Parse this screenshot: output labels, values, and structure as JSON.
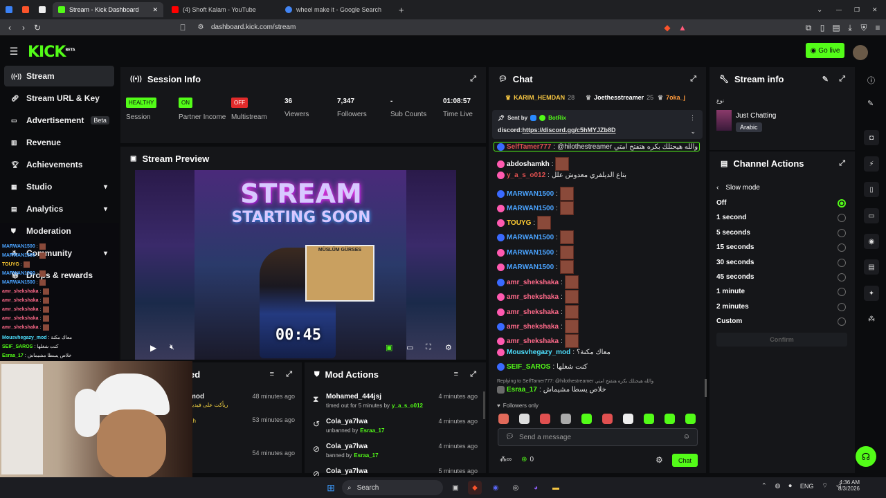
{
  "browser": {
    "tabs": [
      {
        "title": "Stream - Kick Dashboard",
        "color": "#53fc18"
      },
      {
        "title": "(4) Shoft Kalam - YouTube",
        "color": "#ff0000"
      },
      {
        "title": "wheel make it - Google Search",
        "color": "#4285f4"
      }
    ],
    "url": "dashboard.kick.com/stream",
    "new_tab": "+"
  },
  "header": {
    "logo": "KICK",
    "logo_badge": "BETA",
    "go_live": "Go live"
  },
  "sidebar": {
    "items": [
      {
        "label": "Stream",
        "icon": "broadcast-icon",
        "active": true
      },
      {
        "label": "Stream URL & Key",
        "icon": "link-icon"
      },
      {
        "label": "Advertisement",
        "icon": "ad-icon",
        "badge": "Beta"
      },
      {
        "label": "Revenue",
        "icon": "revenue-icon"
      },
      {
        "label": "Achievements",
        "icon": "trophy-icon"
      },
      {
        "label": "Studio",
        "icon": "studio-icon",
        "expand": "▾"
      },
      {
        "label": "Analytics",
        "icon": "analytics-icon",
        "expand": "▾"
      },
      {
        "label": "Moderation",
        "icon": "shield-icon"
      },
      {
        "label": "Community",
        "icon": "community-icon",
        "expand": "▾"
      },
      {
        "label": "Drops & rewards",
        "icon": "gift-icon"
      }
    ]
  },
  "session": {
    "title": "Session Info",
    "stats": [
      {
        "badge": "HEALTHY",
        "label": "Session",
        "badge_color": "#53fc18"
      },
      {
        "badge": "ON",
        "label": "Partner Income",
        "badge_color": "#53fc18"
      },
      {
        "badge": "OFF",
        "label": "Multistream",
        "badge_color": "#e02b2b"
      },
      {
        "value": "36",
        "label": "Viewers"
      },
      {
        "value": "7,347",
        "label": "Followers"
      },
      {
        "value": "-",
        "label": "Sub Counts"
      },
      {
        "value": "01:08:57",
        "label": "Time Live"
      }
    ]
  },
  "preview": {
    "title": "Stream Preview",
    "line1": "STREAM",
    "line2": "STARTING SOON",
    "countdown": "00:45",
    "poster_name": "MÜSLÜM GÜRSES"
  },
  "recent": {
    "title": "ed",
    "rows": [
      {
        "name": "mod",
        "sub": "ريأكت على فيديو",
        "time": "48 minutes ago"
      },
      {
        "name": "",
        "sub": "ah",
        "time": "53 minutes ago"
      },
      {
        "name": "",
        "sub": "",
        "time": "54 minutes ago"
      }
    ]
  },
  "mod_actions": {
    "title": "Mod Actions",
    "rows": [
      {
        "name": "Mohamed_444jsj",
        "sub": "timed out for 5 minutes by",
        "by": "y_a_s_o012",
        "time": "4 minutes ago",
        "icon": "hourglass-icon"
      },
      {
        "name": "Cola_ya7lwa",
        "sub": "unbanned by",
        "by": "Esraa_17",
        "time": "4 minutes ago",
        "icon": "undo-icon"
      },
      {
        "name": "Cola_ya7lwa",
        "sub": "banned by",
        "by": "Esraa_17",
        "time": "4 minutes ago",
        "icon": "ban-icon"
      },
      {
        "name": "Cola_ya7lwa",
        "sub": "",
        "by": "",
        "time": "5 minutes ago",
        "icon": "ban-icon"
      }
    ]
  },
  "chat": {
    "title": "Chat",
    "top_users": [
      {
        "name": "KARIM_HEMDAN",
        "count": "28"
      },
      {
        "name": "Joethesstreamer",
        "count": "25"
      },
      {
        "name": "7oka_j",
        "count": ""
      }
    ],
    "pinned": {
      "sent_by": "Sent by",
      "bot": "BotRix",
      "text": "discord:",
      "link": "https://discord.gg/c5hMYJZb8D"
    },
    "messages": [
      {
        "user": "SelfTamer777",
        "color": "#e05050",
        "text": "@hilothestreamer والله هيحتلك بكره هتفتح امتي",
        "highlight": true
      },
      {
        "user": "abdoshamkh",
        "color": "#ffffff",
        "text": "",
        "emote": true
      },
      {
        "user": "y_a_s_o012",
        "color": "#e05050",
        "text": "بتاع الديلفري معدوش علل"
      },
      {
        "user": "MARWAN1500",
        "color": "#4aa3ff",
        "text": "",
        "emote": true
      },
      {
        "user": "MARWAN1500",
        "color": "#4aa3ff",
        "text": "",
        "emote": true
      },
      {
        "user": "TOUYG",
        "color": "#ffcc33",
        "text": "",
        "emote": true
      },
      {
        "user": "MARWAN1500",
        "color": "#4aa3ff",
        "text": "",
        "emote": true
      },
      {
        "user": "MARWAN1500",
        "color": "#4aa3ff",
        "text": "",
        "emote": true
      },
      {
        "user": "MARWAN1500",
        "color": "#4aa3ff",
        "text": "",
        "emote": true
      },
      {
        "user": "amr_shekshaka",
        "color": "#ff6a8a",
        "text": "",
        "emote": true
      },
      {
        "user": "amr_shekshaka",
        "color": "#ff6a8a",
        "text": "",
        "emote": true
      },
      {
        "user": "amr_shekshaka",
        "color": "#ff6a8a",
        "text": "",
        "emote": true
      },
      {
        "user": "amr_shekshaka",
        "color": "#ff6a8a",
        "text": "",
        "emote": true
      },
      {
        "user": "amr_shekshaka",
        "color": "#ff6a8a",
        "text": "",
        "emote": true
      },
      {
        "user": "Mousvhegazy_mod",
        "color": "#4ee0ff",
        "text": "معاك مكنة؟"
      },
      {
        "user": "SEIF_SAROS",
        "color": "#53fc18",
        "text": "كنت شغلها"
      }
    ],
    "reply_to": "Replying to SelfTamer777: @hilothestreamer والله هيحتلك بكره هتفتح امتي",
    "last_message": {
      "user": "Esraa_17",
      "color": "#53fc18",
      "text": "خلاص يسطا مشيماش"
    },
    "followers_only": "Followers only",
    "input_placeholder": "Send a message",
    "send": "Chat",
    "kick_count": "0",
    "infinity": "∞"
  },
  "stream_info": {
    "title": "Stream info",
    "stream_title": "نوع",
    "category": "Just Chatting",
    "language": "Arabic"
  },
  "channel_actions": {
    "title": "Channel Actions",
    "back": "Slow mode",
    "options": [
      "Off",
      "1 second",
      "5 seconds",
      "15 seconds",
      "30 seconds",
      "45 seconds",
      "1 minute",
      "2 minutes",
      "Custom"
    ],
    "selected": "Off",
    "confirm": "Confirm"
  },
  "overlay_chat": [
    {
      "user": "MARWAN1500",
      "color": "#4aa3ff"
    },
    {
      "user": "MARWAN1500",
      "color": "#4aa3ff"
    },
    {
      "user": "TOUYG",
      "color": "#ffcc33"
    },
    {
      "user": "MARWAN1500",
      "color": "#4aa3ff"
    },
    {
      "user": "MARWAN1500",
      "color": "#4aa3ff"
    },
    {
      "user": "amr_shekshaka",
      "color": "#ff6a8a"
    },
    {
      "user": "amr_shekshaka",
      "color": "#ff6a8a"
    },
    {
      "user": "amr_shekshaka",
      "color": "#ff6a8a"
    },
    {
      "user": "amr_shekshaka",
      "color": "#ff6a8a"
    },
    {
      "user": "amr_shekshaka",
      "color": "#ff6a8a"
    }
  ],
  "overlay_text": [
    {
      "user": "Mousvhegazy_mod",
      "color": "#4ee0ff",
      "text": "معاك مكنة"
    },
    {
      "user": "SEIF_SAROS",
      "color": "#53fc18",
      "text": "كنت شغلها"
    },
    {
      "user": "Esraa_17",
      "color": "#53fc18",
      "text": "خلاص يسطا مشيماش"
    }
  ],
  "taskbar": {
    "search": "Search",
    "lang": "ENG",
    "time": "4:36 AM",
    "date": "8/3/2026"
  },
  "colors": {
    "accent": "#53fc18",
    "panel": "#151619",
    "bg": "#0b0c0e"
  }
}
